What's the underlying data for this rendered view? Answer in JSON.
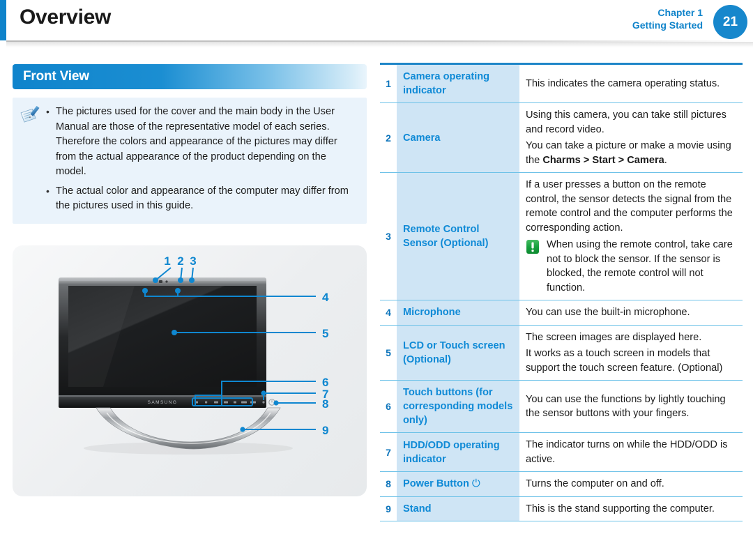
{
  "header": {
    "title": "Overview",
    "chapter_line1": "Chapter 1",
    "chapter_line2": "Getting Started",
    "page_number": "21"
  },
  "section": {
    "heading": "Front View"
  },
  "note": {
    "icon": "note-pen-icon",
    "bullets": [
      "The pictures used for the cover and the main body in the User Manual are those of the representative model of each series. Therefore the colors and appearance of the pictures may differ from the actual appearance of the product depending on the model.",
      "The actual color and appearance of the computer may differ from the pictures used in this guide."
    ],
    "bullet_char": "•"
  },
  "illustration": {
    "brand": "SAMSUNG",
    "callouts": [
      "1",
      "2",
      "3",
      "4",
      "5",
      "6",
      "7",
      "8",
      "9"
    ]
  },
  "table": {
    "rows": [
      {
        "num": "1",
        "label": "Camera operating indicator",
        "desc": [
          "This indicates the camera operating status."
        ]
      },
      {
        "num": "2",
        "label": "Camera",
        "desc": [
          "Using this camera, you can take still pictures and record video."
        ],
        "desc_rich": {
          "prefix": "You can take a picture or make a movie using the ",
          "bold": "Charms > Start > Camera",
          "suffix": "."
        }
      },
      {
        "num": "3",
        "label": "Remote Control Sensor (Optional)",
        "desc": [
          "If a user presses a button on the remote control, the sensor detects the signal from the remote control and the computer performs the corresponding action."
        ],
        "caution": {
          "icon": "caution-exclamation-icon",
          "text": "When using the remote control, take care not to block the sensor. If the sensor is blocked, the remote control will not function."
        }
      },
      {
        "num": "4",
        "label": "Microphone",
        "desc": [
          "You can use the built-in microphone."
        ]
      },
      {
        "num": "5",
        "label": "LCD or Touch screen (Optional)",
        "desc": [
          "The screen images are displayed here.",
          "It works as a touch screen in models that support the touch screen feature. (Optional)"
        ]
      },
      {
        "num": "6",
        "label": "Touch buttons (for corresponding models only)",
        "desc": [
          "You can use the functions by lightly touching the sensor buttons with your fingers."
        ]
      },
      {
        "num": "7",
        "label": "HDD/ODD operating indicator",
        "desc": [
          "The indicator turns on while the HDD/ODD is active."
        ]
      },
      {
        "num": "8",
        "label": "Power Button",
        "label_glyph": "⏻",
        "desc": [
          "Turns the computer on and off."
        ]
      },
      {
        "num": "9",
        "label": "Stand",
        "desc": [
          "This is the stand supporting the computer."
        ]
      }
    ]
  },
  "colors": {
    "accent_blue": "#0f84cc",
    "label_blue": "#0f8ad6",
    "panel_blue": "#cfe5f5",
    "note_bg": "#eaf3fb",
    "rule_blue": "#6ec2e8",
    "caution_green": "#2aa545"
  }
}
